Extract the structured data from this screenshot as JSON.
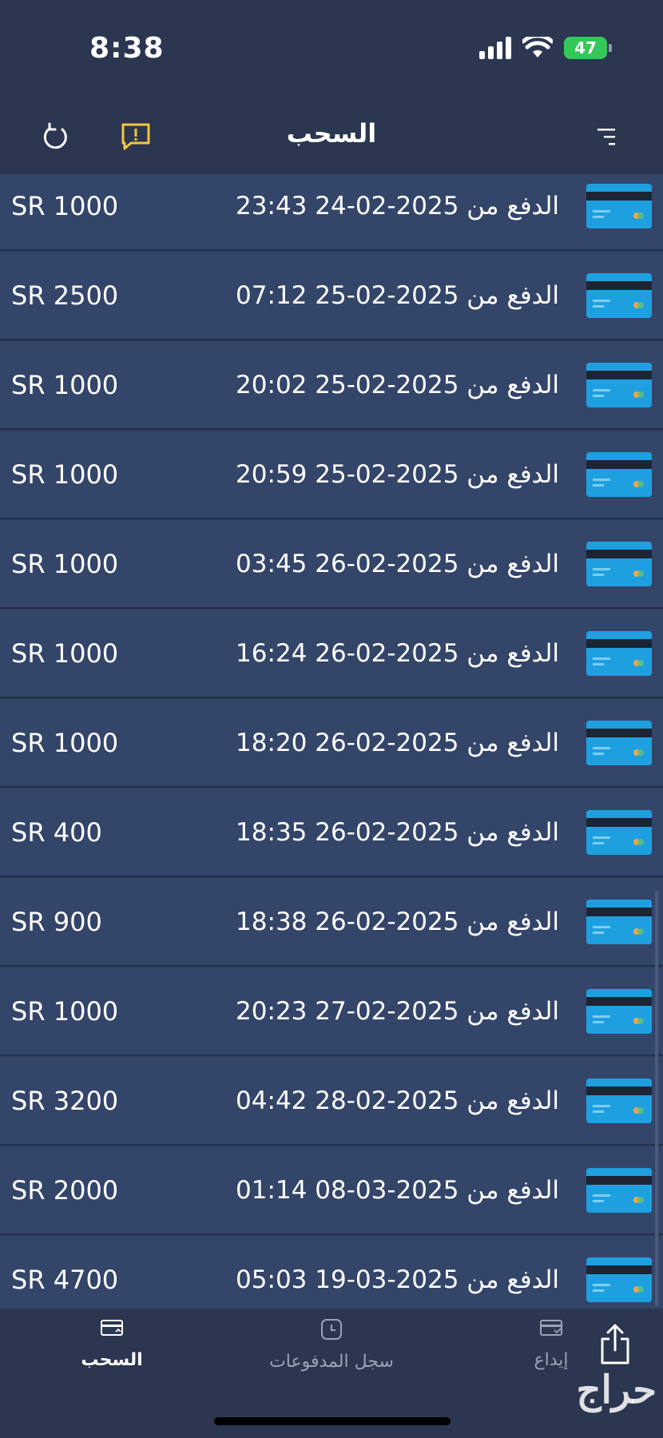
{
  "status": {
    "time": "8:38",
    "battery": "47"
  },
  "header": {
    "title": "السحب"
  },
  "rows": [
    {
      "desc": "الدفع من 2025-02-24 23:43",
      "amount": "SR 1000"
    },
    {
      "desc": "الدفع من 2025-02-25 07:12",
      "amount": "SR 2500"
    },
    {
      "desc": "الدفع من 2025-02-25 20:02",
      "amount": "SR 1000"
    },
    {
      "desc": "الدفع من 2025-02-25 20:59",
      "amount": "SR 1000"
    },
    {
      "desc": "الدفع من 2025-02-26 03:45",
      "amount": "SR 1000"
    },
    {
      "desc": "الدفع من 2025-02-26 16:24",
      "amount": "SR 1000"
    },
    {
      "desc": "الدفع من 2025-02-26 18:20",
      "amount": "SR 1000"
    },
    {
      "desc": "الدفع من 2025-02-26 18:35",
      "amount": "SR 400"
    },
    {
      "desc": "الدفع من 2025-02-26 18:38",
      "amount": "SR 900"
    },
    {
      "desc": "الدفع من 2025-02-27 20:23",
      "amount": "SR 1000"
    },
    {
      "desc": "الدفع من 2025-02-28 04:42",
      "amount": "SR 3200"
    },
    {
      "desc": "الدفع من 2025-03-08 01:14",
      "amount": "SR 2000"
    },
    {
      "desc": "الدفع من 2025-03-19 05:03",
      "amount": "SR 4700"
    }
  ],
  "tabs": {
    "withdraw": "السحب",
    "payments_log": "سجل المدفوعات",
    "deposit": "إيداع"
  },
  "watermark": "حراج",
  "colors": {
    "background": "#2f3d5a",
    "row": "#34456a",
    "accent_alert": "#f5c542",
    "card": "#1ea0e0",
    "battery": "#34c759"
  }
}
